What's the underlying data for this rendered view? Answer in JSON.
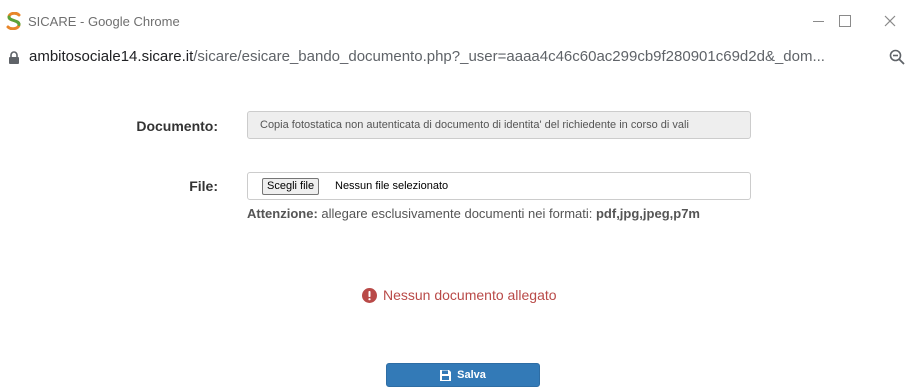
{
  "window": {
    "title": "SICARE - Google Chrome"
  },
  "address_bar": {
    "host": "ambitosociale14.sicare.it",
    "path": "/sicare/esicare_bando_documento.php?_user=aaaa4c46c60ac299cb9f280901c69d2d&_dom..."
  },
  "form": {
    "documento_label": "Documento:",
    "documento_value": "Copia fotostatica non autenticata di documento di identita' del richiedente in corso di vali",
    "file_label": "File:",
    "file_button": "Scegli file",
    "file_status": "Nessun file selezionato",
    "hint_prefix": "Attenzione:",
    "hint_text": " allegare esclusivamente documenti nei formati: ",
    "hint_formats": "pdf,jpg,jpeg,p7m"
  },
  "alert": {
    "text": "Nessun documento allegato",
    "color": "#b94a48"
  },
  "actions": {
    "save_label": "Salva",
    "save_color": "#337ab7"
  }
}
